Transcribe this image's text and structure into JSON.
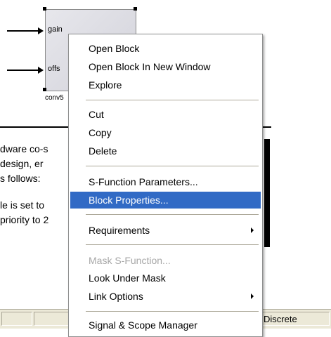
{
  "block": {
    "ports": [
      "gain",
      "offs"
    ],
    "name": "conv5"
  },
  "description": {
    "lines": [
      "dware co-s",
      "design, er",
      "s follows:",
      "",
      "le is set to",
      "priority to 2"
    ]
  },
  "status_bar": {
    "cells": [
      "",
      "",
      "",
      "",
      "Discrete"
    ]
  },
  "context_menu": {
    "items": [
      {
        "label": "Open Block"
      },
      {
        "label": "Open Block In New Window"
      },
      {
        "label": "Explore"
      },
      {
        "label": "Cut"
      },
      {
        "label": "Copy"
      },
      {
        "label": "Delete"
      },
      {
        "label": "S-Function Parameters..."
      },
      {
        "label": "Block Properties..."
      },
      {
        "label": "Requirements"
      },
      {
        "label": "Mask S-Function..."
      },
      {
        "label": "Look Under Mask"
      },
      {
        "label": "Link Options"
      },
      {
        "label": "Signal & Scope Manager"
      }
    ],
    "selected": "Block Properties...",
    "disabled": [
      "Mask S-Function..."
    ],
    "submenus": [
      "Requirements",
      "Link Options"
    ]
  },
  "colors": {
    "selection": "#316ac5",
    "disabled_text": "#a7a7a7",
    "statusbar": "#ece9d8"
  }
}
